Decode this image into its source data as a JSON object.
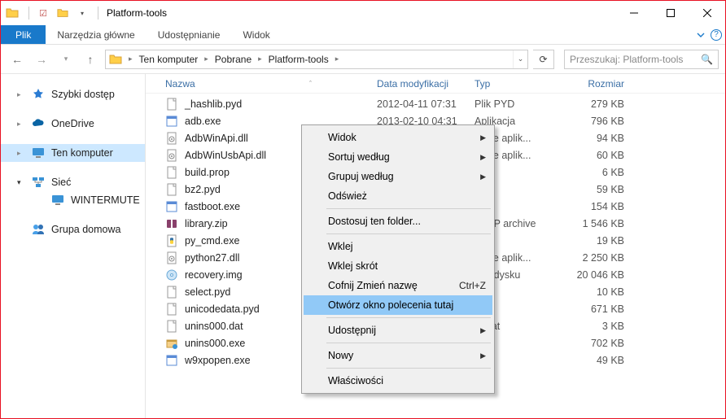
{
  "titlebar": {
    "title": "Platform-tools"
  },
  "ribbon": {
    "file": "Plik",
    "tabs": [
      "Narzędzia główne",
      "Udostępnianie",
      "Widok"
    ]
  },
  "address": {
    "segments": [
      "Ten komputer",
      "Pobrane",
      "Platform-tools"
    ]
  },
  "search": {
    "placeholder": "Przeszukaj: Platform-tools"
  },
  "navpane": {
    "quick": "Szybki dostęp",
    "onedrive": "OneDrive",
    "thispc": "Ten komputer",
    "network": "Sieć",
    "netchild": "WINTERMUTE",
    "homegrp": "Grupa domowa"
  },
  "columns": {
    "name": "Nazwa",
    "date": "Data modyfikacji",
    "type": "Typ",
    "size": "Rozmiar"
  },
  "files": [
    {
      "icon": "file",
      "name": "_hashlib.pyd",
      "date": "2012-04-11 07:31",
      "type": "Plik PYD",
      "size": "279 KB"
    },
    {
      "icon": "exe",
      "name": "adb.exe",
      "date": "2013-02-10 04:31",
      "type": "Aplikacja",
      "size": "796 KB"
    },
    {
      "icon": "dll",
      "name": "AdbWinApi.dll",
      "date": "",
      "type": "zenie aplik...",
      "size": "94 KB"
    },
    {
      "icon": "dll",
      "name": "AdbWinUsbApi.dll",
      "date": "",
      "type": "zenie aplik...",
      "size": "60 KB"
    },
    {
      "icon": "file",
      "name": "build.prop",
      "date": "",
      "type": "OP",
      "size": "6 KB"
    },
    {
      "icon": "file",
      "name": "bz2.pyd",
      "date": "",
      "type": "D",
      "size": "59 KB"
    },
    {
      "icon": "exe",
      "name": "fastboot.exe",
      "date": "",
      "type": "a",
      "size": "154 KB"
    },
    {
      "icon": "zip",
      "name": "library.zip",
      "date": "",
      "type": "R ZIP archive",
      "size": "1 546 KB"
    },
    {
      "icon": "py",
      "name": "py_cmd.exe",
      "date": "",
      "type": "a",
      "size": "19 KB"
    },
    {
      "icon": "dll",
      "name": "python27.dll",
      "date": "",
      "type": "zenie aplik...",
      "size": "2 250 KB"
    },
    {
      "icon": "disc",
      "name": "recovery.img",
      "date": "",
      "type": "azu dysku",
      "size": "20 046 KB"
    },
    {
      "icon": "file",
      "name": "select.pyd",
      "date": "",
      "type": "D",
      "size": "10 KB"
    },
    {
      "icon": "file",
      "name": "unicodedata.pyd",
      "date": "",
      "type": "D",
      "size": "671 KB"
    },
    {
      "icon": "file",
      "name": "unins000.dat",
      "date": "",
      "type": "er.dat",
      "size": "3 KB"
    },
    {
      "icon": "uninst",
      "name": "unins000.exe",
      "date": "",
      "type": "a",
      "size": "702 KB"
    },
    {
      "icon": "exe",
      "name": "w9xpopen.exe",
      "date": "",
      "type": "a",
      "size": "49 KB"
    }
  ],
  "ctx": {
    "view": "Widok",
    "sort": "Sortuj według",
    "group": "Grupuj według",
    "refresh": "Odśwież",
    "customize": "Dostosuj ten folder...",
    "paste": "Wklej",
    "pasteShortcut": "Wklej skrót",
    "undo": "Cofnij Zmień nazwę",
    "undoKey": "Ctrl+Z",
    "openCmd": "Otwórz okno polecenia tutaj",
    "share": "Udostępnij",
    "new": "Nowy",
    "props": "Właściwości"
  }
}
